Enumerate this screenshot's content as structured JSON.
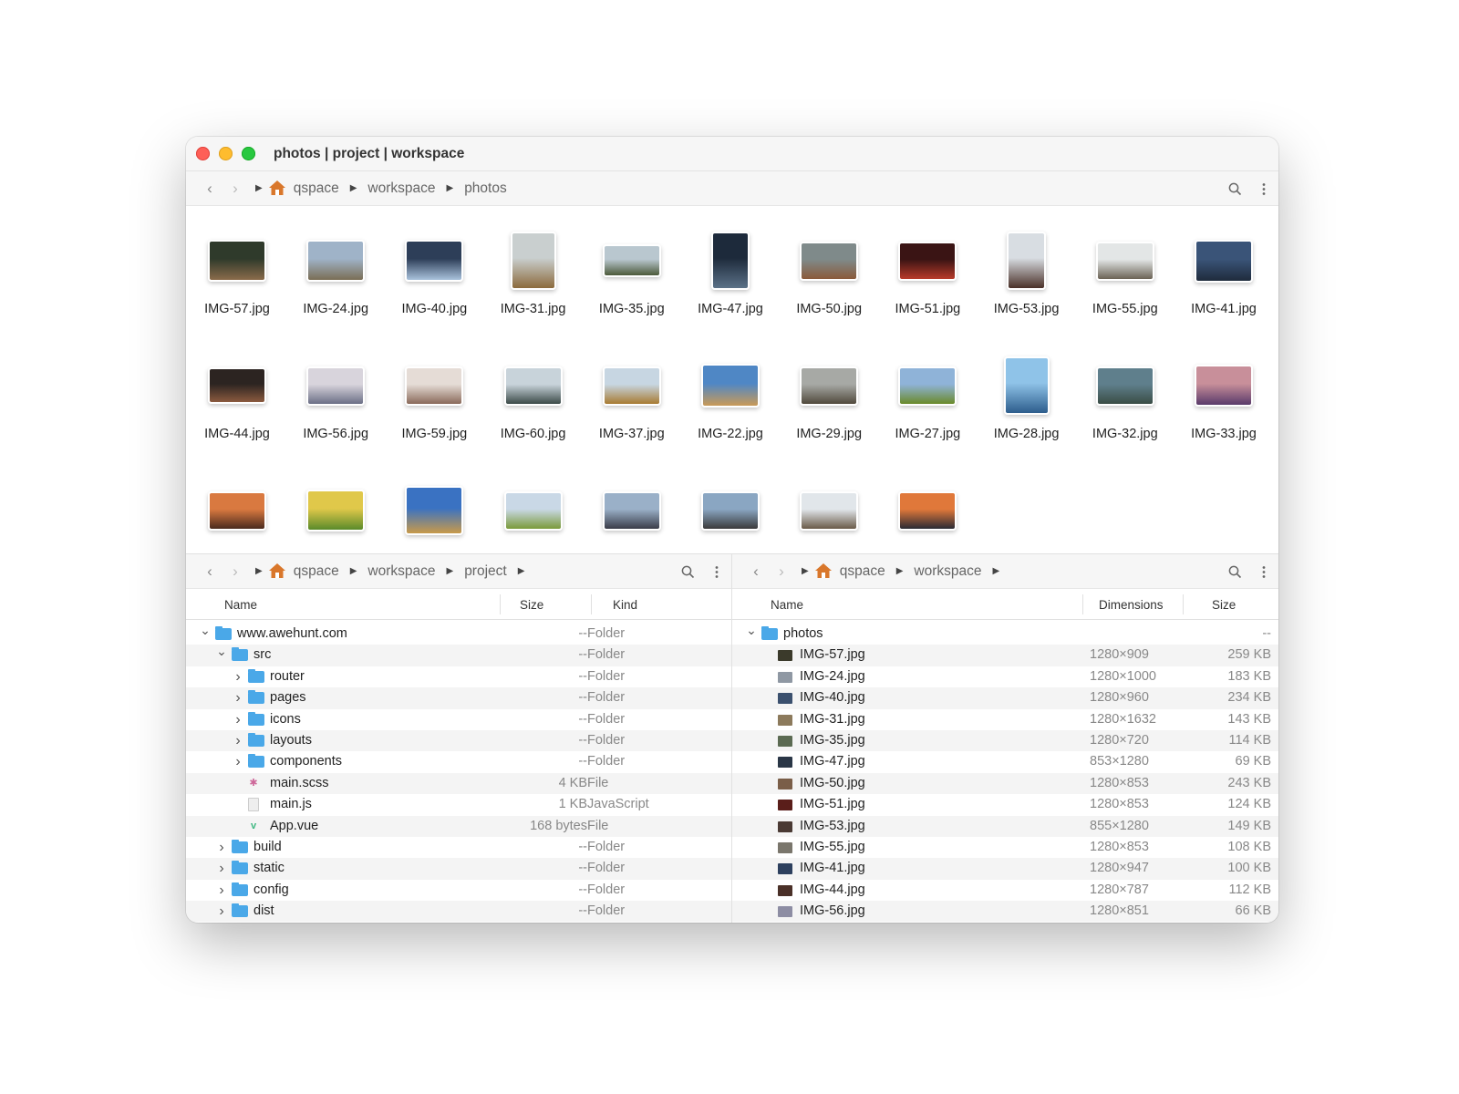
{
  "window": {
    "title": "photos | project | workspace"
  },
  "top_toolbar": {
    "crumbs": [
      "qspace",
      "workspace",
      "photos"
    ]
  },
  "grid": {
    "items": [
      {
        "label": "IMG-57.jpg",
        "c1": "#2f3a2b",
        "c2": "#8a6b4a"
      },
      {
        "label": "IMG-24.jpg",
        "c1": "#9fb3c8",
        "c2": "#7a6d55"
      },
      {
        "label": "IMG-40.jpg",
        "c1": "#2d3e58",
        "c2": "#a9c2dc"
      },
      {
        "label": "IMG-31.jpg",
        "c1": "#c9cfcf",
        "c2": "#8c6a3c"
      },
      {
        "label": "IMG-35.jpg",
        "c1": "#b9c7cf",
        "c2": "#4c5a3a"
      },
      {
        "label": "IMG-47.jpg",
        "c1": "#1d2a3b",
        "c2": "#5b7187"
      },
      {
        "label": "IMG-50.jpg",
        "c1": "#7f8a8a",
        "c2": "#8a5a3a"
      },
      {
        "label": "IMG-51.jpg",
        "c1": "#3a1414",
        "c2": "#b83a2a"
      },
      {
        "label": "IMG-53.jpg",
        "c1": "#d8dde2",
        "c2": "#4a3028"
      },
      {
        "label": "IMG-55.jpg",
        "c1": "#e3e6e6",
        "c2": "#6b6355"
      },
      {
        "label": "IMG-41.jpg",
        "c1": "#3a5478",
        "c2": "#1f2b3c"
      },
      {
        "label": "IMG-44.jpg",
        "c1": "#2c2421",
        "c2": "#8a5a3e"
      },
      {
        "label": "IMG-56.jpg",
        "c1": "#d8d4dc",
        "c2": "#6b6f86"
      },
      {
        "label": "IMG-59.jpg",
        "c1": "#e5dcd6",
        "c2": "#8a6a5a"
      },
      {
        "label": "IMG-60.jpg",
        "c1": "#c8d3da",
        "c2": "#3b4a48"
      },
      {
        "label": "IMG-37.jpg",
        "c1": "#c7d6e2",
        "c2": "#a87b32"
      },
      {
        "label": "IMG-22.jpg",
        "c1": "#4f87c5",
        "c2": "#c99a58"
      },
      {
        "label": "IMG-29.jpg",
        "c1": "#a7a9a5",
        "c2": "#514a3d"
      },
      {
        "label": "IMG-27.jpg",
        "c1": "#8fb3d8",
        "c2": "#6a8a2a"
      },
      {
        "label": "IMG-28.jpg",
        "c1": "#8fc3e8",
        "c2": "#2d5d8c"
      },
      {
        "label": "IMG-32.jpg",
        "c1": "#5f7f8c",
        "c2": "#3a4d45"
      },
      {
        "label": "IMG-33.jpg",
        "c1": "#c88f9a",
        "c2": "#5a3a6a"
      },
      {
        "label": "",
        "c1": "#d97940",
        "c2": "#4a2a1e"
      },
      {
        "label": "",
        "c1": "#e0c84a",
        "c2": "#5a8a2a"
      },
      {
        "label": "",
        "c1": "#3a72c2",
        "c2": "#c89a4a"
      },
      {
        "label": "",
        "c1": "#c9d8e6",
        "c2": "#7a9a3a"
      },
      {
        "label": "",
        "c1": "#9ab0c8",
        "c2": "#3a3c48"
      },
      {
        "label": "",
        "c1": "#8aa6c2",
        "c2": "#3a3a3a"
      },
      {
        "label": "",
        "c1": "#e1e6ea",
        "c2": "#6a5a48"
      },
      {
        "label": "",
        "c1": "#e0783a",
        "c2": "#2a2a34"
      }
    ]
  },
  "left_pane": {
    "crumbs": [
      "qspace",
      "workspace",
      "project"
    ],
    "headers": {
      "name": "Name",
      "size": "Size",
      "kind": "Kind"
    },
    "rows": [
      {
        "name": "www.awehunt.com",
        "size": "--",
        "kind": "Folder",
        "indent": 0,
        "type": "folder",
        "expanded": true
      },
      {
        "name": "src",
        "size": "--",
        "kind": "Folder",
        "indent": 1,
        "type": "folder",
        "expanded": true
      },
      {
        "name": "router",
        "size": "--",
        "kind": "Folder",
        "indent": 2,
        "type": "folder",
        "expanded": false
      },
      {
        "name": "pages",
        "size": "--",
        "kind": "Folder",
        "indent": 2,
        "type": "folder",
        "expanded": false
      },
      {
        "name": "icons",
        "size": "--",
        "kind": "Folder",
        "indent": 2,
        "type": "folder",
        "expanded": false
      },
      {
        "name": "layouts",
        "size": "--",
        "kind": "Folder",
        "indent": 2,
        "type": "folder",
        "expanded": false
      },
      {
        "name": "components",
        "size": "--",
        "kind": "Folder",
        "indent": 2,
        "type": "folder",
        "expanded": false
      },
      {
        "name": "main.scss",
        "size": "4 KB",
        "kind": "File",
        "indent": 2,
        "type": "scss"
      },
      {
        "name": "main.js",
        "size": "1 KB",
        "kind": "JavaScript",
        "indent": 2,
        "type": "js"
      },
      {
        "name": "App.vue",
        "size": "168 bytes",
        "kind": "File",
        "indent": 2,
        "type": "vue"
      },
      {
        "name": "build",
        "size": "--",
        "kind": "Folder",
        "indent": 1,
        "type": "folder",
        "expanded": false
      },
      {
        "name": "static",
        "size": "--",
        "kind": "Folder",
        "indent": 1,
        "type": "folder",
        "expanded": false
      },
      {
        "name": "config",
        "size": "--",
        "kind": "Folder",
        "indent": 1,
        "type": "folder",
        "expanded": false
      },
      {
        "name": "dist",
        "size": "--",
        "kind": "Folder",
        "indent": 1,
        "type": "folder",
        "expanded": false
      }
    ]
  },
  "right_pane": {
    "crumbs": [
      "qspace",
      "workspace"
    ],
    "headers": {
      "name": "Name",
      "dimensions": "Dimensions",
      "size": "Size"
    },
    "rows": [
      {
        "name": "photos",
        "dim": "",
        "size": "--",
        "indent": 0,
        "type": "folder",
        "expanded": true
      },
      {
        "name": "IMG-57.jpg",
        "dim": "1280×909",
        "size": "259 KB",
        "indent": 1,
        "type": "image",
        "color": "#3b3a2b"
      },
      {
        "name": "IMG-24.jpg",
        "dim": "1280×1000",
        "size": "183 KB",
        "indent": 1,
        "type": "image",
        "color": "#8f98a3"
      },
      {
        "name": "IMG-40.jpg",
        "dim": "1280×960",
        "size": "234 KB",
        "indent": 1,
        "type": "image",
        "color": "#3b506e"
      },
      {
        "name": "IMG-31.jpg",
        "dim": "1280×1632",
        "size": "143 KB",
        "indent": 1,
        "type": "image",
        "color": "#8c7a5c"
      },
      {
        "name": "IMG-35.jpg",
        "dim": "1280×720",
        "size": "114 KB",
        "indent": 1,
        "type": "image",
        "color": "#5b6a52"
      },
      {
        "name": "IMG-47.jpg",
        "dim": "853×1280",
        "size": "69 KB",
        "indent": 1,
        "type": "image",
        "color": "#2a3646"
      },
      {
        "name": "IMG-50.jpg",
        "dim": "1280×853",
        "size": "243 KB",
        "indent": 1,
        "type": "image",
        "color": "#7a5e48"
      },
      {
        "name": "IMG-51.jpg",
        "dim": "1280×853",
        "size": "124 KB",
        "indent": 1,
        "type": "image",
        "color": "#5a1e1a"
      },
      {
        "name": "IMG-53.jpg",
        "dim": "855×1280",
        "size": "149 KB",
        "indent": 1,
        "type": "image",
        "color": "#4a3a34"
      },
      {
        "name": "IMG-55.jpg",
        "dim": "1280×853",
        "size": "108 KB",
        "indent": 1,
        "type": "image",
        "color": "#7a766c"
      },
      {
        "name": "IMG-41.jpg",
        "dim": "1280×947",
        "size": "100 KB",
        "indent": 1,
        "type": "image",
        "color": "#2d405e"
      },
      {
        "name": "IMG-44.jpg",
        "dim": "1280×787",
        "size": "112 KB",
        "indent": 1,
        "type": "image",
        "color": "#4a3028"
      },
      {
        "name": "IMG-56.jpg",
        "dim": "1280×851",
        "size": "66 KB",
        "indent": 1,
        "type": "image",
        "color": "#8d8da3"
      }
    ]
  }
}
